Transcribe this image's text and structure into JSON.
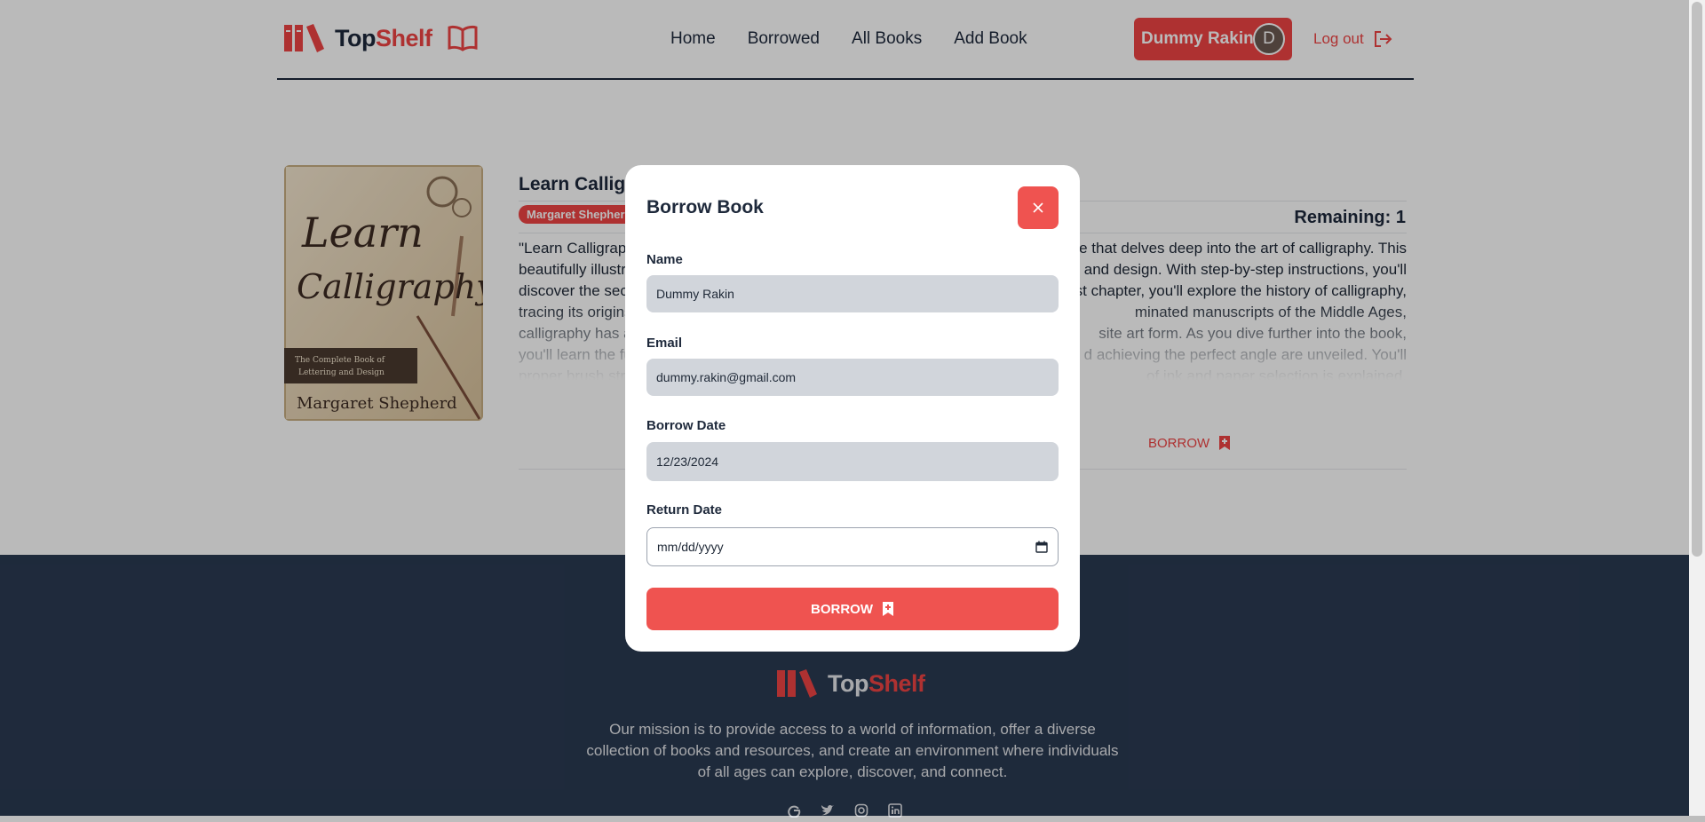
{
  "nav": {
    "logo": {
      "part1": "Top",
      "part2": "Shelf"
    },
    "links": [
      "Home",
      "Borrowed",
      "All Books",
      "Add Book"
    ],
    "user_name": "Dummy Rakin",
    "avatar_initial": "D",
    "logout_label": "Log out"
  },
  "book": {
    "title_visible": "Learn Calligra",
    "author": "Margaret Shepherd",
    "remaining_label": "Remaining:",
    "remaining_value": "1",
    "description_left": [
      "\"Learn Calligraph",
      "beautifully illustra",
      "discover the secre",
      "tracing its origins",
      "calligraphy has a",
      "you'll learn the fu",
      "proper brush str"
    ],
    "description_right": [
      "e that delves deep into the art of calligraphy. This",
      "ing and design. With step-by-step instructions, you'll",
      "st chapter, you'll explore the history of calligraphy,",
      "minated manuscripts of the Middle Ages,",
      "site art form. As you dive further into the book,",
      "d achieving the perfect angle are unveiled. You'll",
      "of ink and paper selection is explained."
    ],
    "cover_text": {
      "title_line1": "Learn",
      "title_line2": "Calligraphy",
      "subtitle_line1": "The Complete Book of",
      "subtitle_line2": "Lettering and Design",
      "author": "Margaret Shepherd"
    },
    "borrow_label": "BORROW"
  },
  "footer": {
    "logo": {
      "part1": "Top",
      "part2": "Shelf"
    },
    "mission": "Our mission is to provide access to a world of information, offer a diverse collection of books and resources, and create an environment where individuals of all ages can explore, discover, and connect."
  },
  "modal": {
    "title": "Borrow Book",
    "close_label": "×",
    "fields": {
      "name": {
        "label": "Name",
        "value": "Dummy Rakin"
      },
      "email": {
        "label": "Email",
        "value": "dummy.rakin@gmail.com"
      },
      "borrow_date": {
        "label": "Borrow Date",
        "value": "12/23/2024"
      },
      "return_date": {
        "label": "Return Date",
        "placeholder": "mm/dd/yyyy"
      }
    },
    "submit_label": "BORROW"
  },
  "colors": {
    "accent": "#ef4444",
    "navy": "#1e293b",
    "footer_bg": "#2a3a52"
  }
}
